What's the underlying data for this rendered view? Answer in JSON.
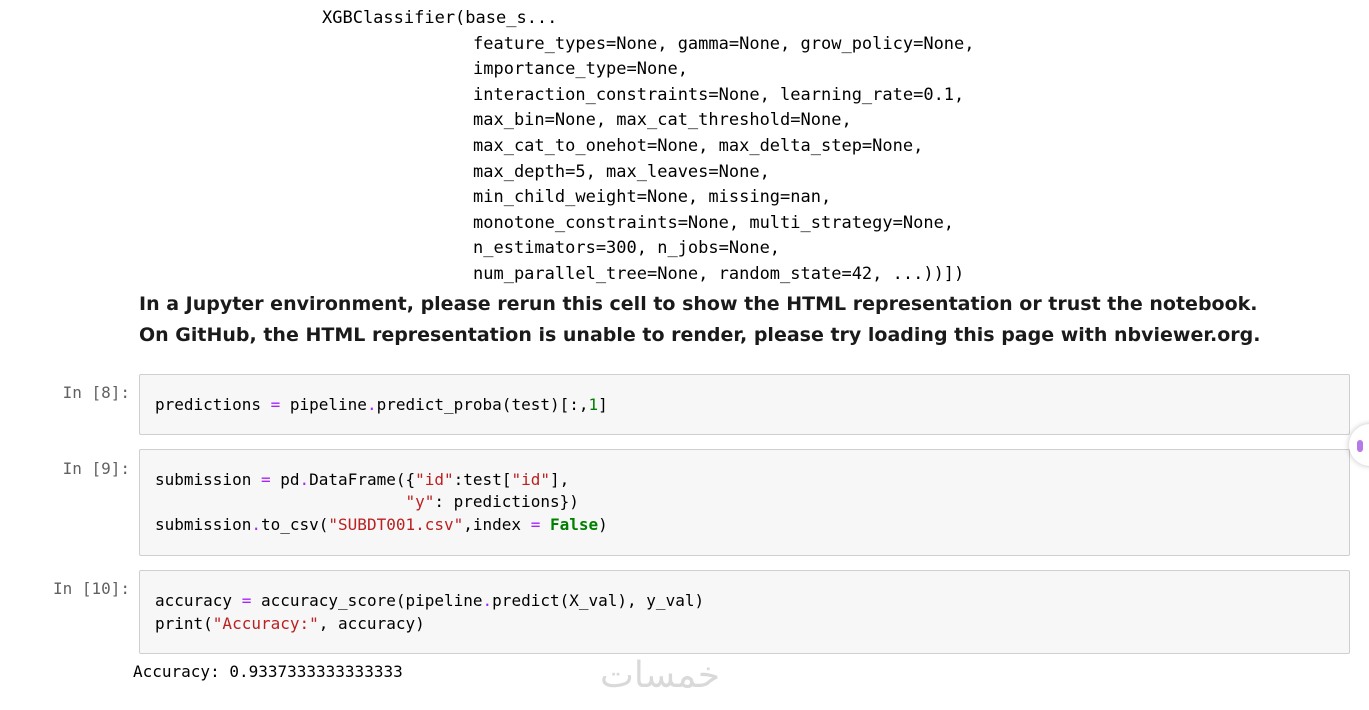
{
  "repr_lines": [
    "XGBClassifier(base_s...",
    "feature_types=None, gamma=None, grow_policy=None,",
    "importance_type=None,",
    "interaction_constraints=None, learning_rate=0.1,",
    "max_bin=None, max_cat_threshold=None,",
    "max_cat_to_onehot=None, max_delta_step=None,",
    "max_depth=5, max_leaves=None,",
    "min_child_weight=None, missing=nan,",
    "monotone_constraints=None, multi_strategy=None,",
    "n_estimators=300, n_jobs=None,",
    "num_parallel_tree=None, random_state=42, ...))])"
  ],
  "notice": {
    "line1": "In a Jupyter environment, please rerun this cell to show the HTML representation or trust the notebook.",
    "line2": "On GitHub, the HTML representation is unable to render, please try loading this page with nbviewer.org."
  },
  "cells": [
    {
      "prompt": "In [8]:",
      "code": {
        "l1_a": "predictions ",
        "l1_op": "=",
        "l1_b": " pipeline",
        "l1_dot": ".",
        "l1_c": "predict_proba(test)[:,",
        "l1_num": "1",
        "l1_d": "]"
      }
    },
    {
      "prompt": "In [9]:",
      "code": {
        "l1_a": "submission ",
        "l1_op": "=",
        "l1_b": " pd",
        "l1_dot": ".",
        "l1_c": "DataFrame({",
        "l1_str1": "\"id\"",
        "l1_d": ":test[",
        "l1_str2": "\"id\"",
        "l1_e": "],",
        "l2_pad": "                          ",
        "l2_str": "\"y\"",
        "l2_a": ": predictions})",
        "l3_a": "submission",
        "l3_dot": ".",
        "l3_b": "to_csv(",
        "l3_str": "\"SUBDT001.csv\"",
        "l3_c": ",index ",
        "l3_op": "=",
        "l3_kw": " False",
        "l3_d": ")"
      }
    },
    {
      "prompt": "In [10]:",
      "code": {
        "l1_a": "accuracy ",
        "l1_op": "=",
        "l1_b": " accuracy_score(pipeline",
        "l1_dot": ".",
        "l1_c": "predict(X_val), y_val)",
        "l2_a": "print(",
        "l2_str": "\"Accuracy:\"",
        "l2_b": ", accuracy)"
      }
    }
  ],
  "output": "Accuracy: 0.9337333333333333",
  "watermark": "خمسات"
}
